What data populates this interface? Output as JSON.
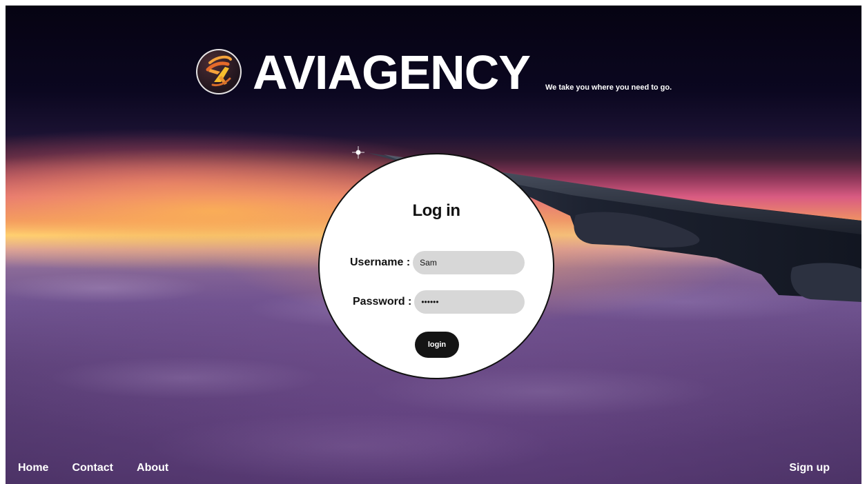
{
  "brand": {
    "name": "AVIAGENCY",
    "tagline": "We take you where you need to go.",
    "logo_icon": "plane-logo-icon"
  },
  "login": {
    "title": "Log in",
    "username_label": "Username :",
    "username_value": "Sam",
    "password_label": "Password :",
    "password_value": "••••••",
    "button_label": "login"
  },
  "footer": {
    "links": [
      "Home",
      "Contact",
      "About"
    ],
    "signup_label": "Sign up"
  },
  "colors": {
    "text_light": "#ffffff",
    "text_dark": "#111111",
    "input_bg": "#d7d7d7",
    "button_bg": "#141414",
    "panel_bg": "#ffffff",
    "logo_accent": "#f4a23b"
  }
}
